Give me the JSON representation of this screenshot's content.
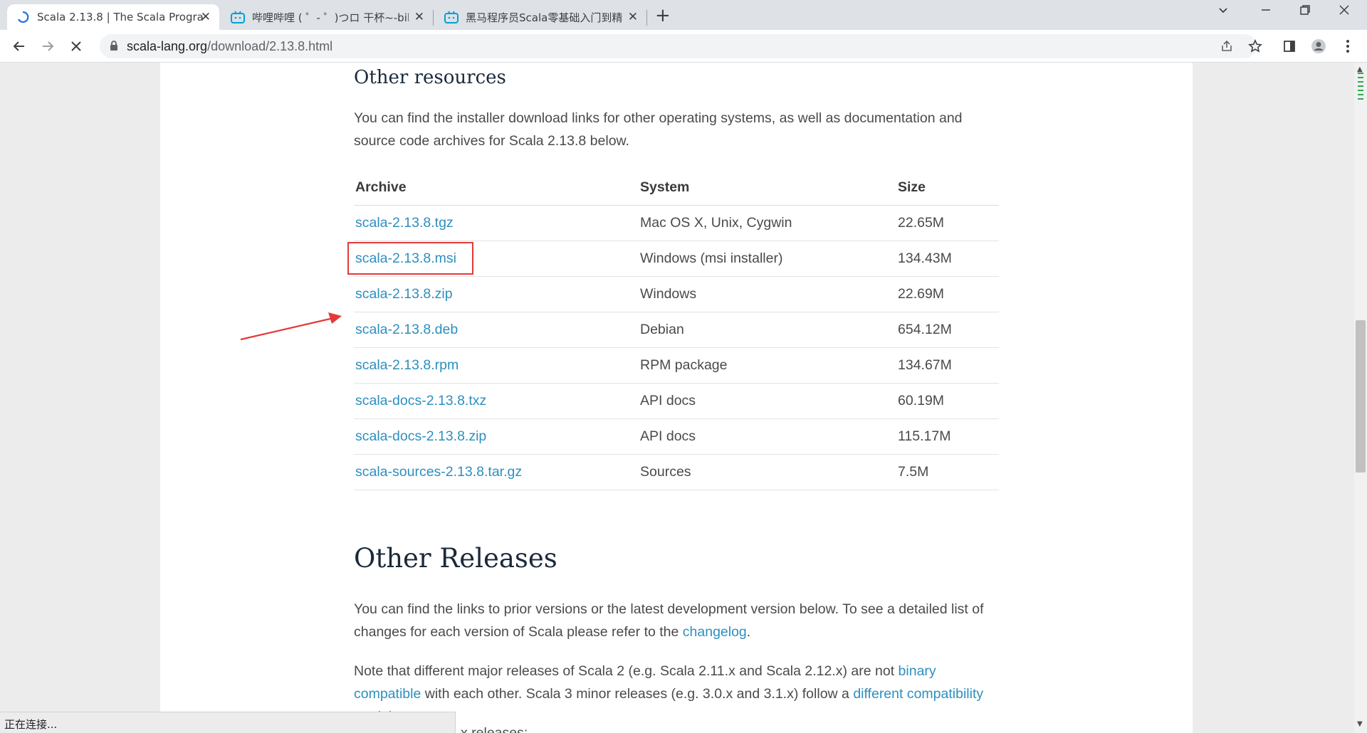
{
  "tabs": [
    {
      "title": "Scala 2.13.8 | The Scala Progra",
      "active": true
    },
    {
      "title": "哔哩哔哩 ( ゜- ゜)つロ 干杯~-bilil",
      "active": false
    },
    {
      "title": "黑马程序员Scala零基础入门到精",
      "active": false
    }
  ],
  "toolbar": {
    "url_host": "scala-lang.org",
    "url_path": "/download/2.13.8.html"
  },
  "page": {
    "resources_heading": "Other resources",
    "resources_intro": "You can find the installer download links for other operating systems, as well as documentation and source code archives for Scala 2.13.8 below.",
    "table": {
      "headers": [
        "Archive",
        "System",
        "Size"
      ],
      "rows": [
        {
          "archive": "scala-2.13.8.tgz",
          "system": "Mac OS X, Unix, Cygwin",
          "size": "22.65M"
        },
        {
          "archive": "scala-2.13.8.msi",
          "system": "Windows (msi installer)",
          "size": "134.43M"
        },
        {
          "archive": "scala-2.13.8.zip",
          "system": "Windows",
          "size": "22.69M"
        },
        {
          "archive": "scala-2.13.8.deb",
          "system": "Debian",
          "size": "654.12M"
        },
        {
          "archive": "scala-2.13.8.rpm",
          "system": "RPM package",
          "size": "134.67M"
        },
        {
          "archive": "scala-docs-2.13.8.txz",
          "system": "API docs",
          "size": "60.19M"
        },
        {
          "archive": "scala-docs-2.13.8.zip",
          "system": "API docs",
          "size": "115.17M"
        },
        {
          "archive": "scala-sources-2.13.8.tar.gz",
          "system": "Sources",
          "size": "7.5M"
        }
      ]
    },
    "releases_heading": "Other Releases",
    "releases_p1_a": "You can find the links to prior versions or the latest development version below. To see a detailed list of changes for each version of Scala please refer to the ",
    "releases_p1_link": "changelog",
    "releases_p1_b": ".",
    "releases_p2_a": "Note that different major releases of Scala 2 (e.g. Scala 2.11.x and Scala 2.12.x) are not ",
    "releases_p2_link1": "binary compatible",
    "releases_p2_b": " with each other. Scala 3 minor releases (e.g. 3.0.x and 3.1.x) follow a ",
    "releases_p2_link2": "different compatibility model",
    "releases_p2_c": " .",
    "releases_p3_partial": "x releases:"
  },
  "status_text": "正在连接...",
  "colors": {
    "link": "#2d8fbe",
    "highlight_box": "#e23a3a"
  }
}
